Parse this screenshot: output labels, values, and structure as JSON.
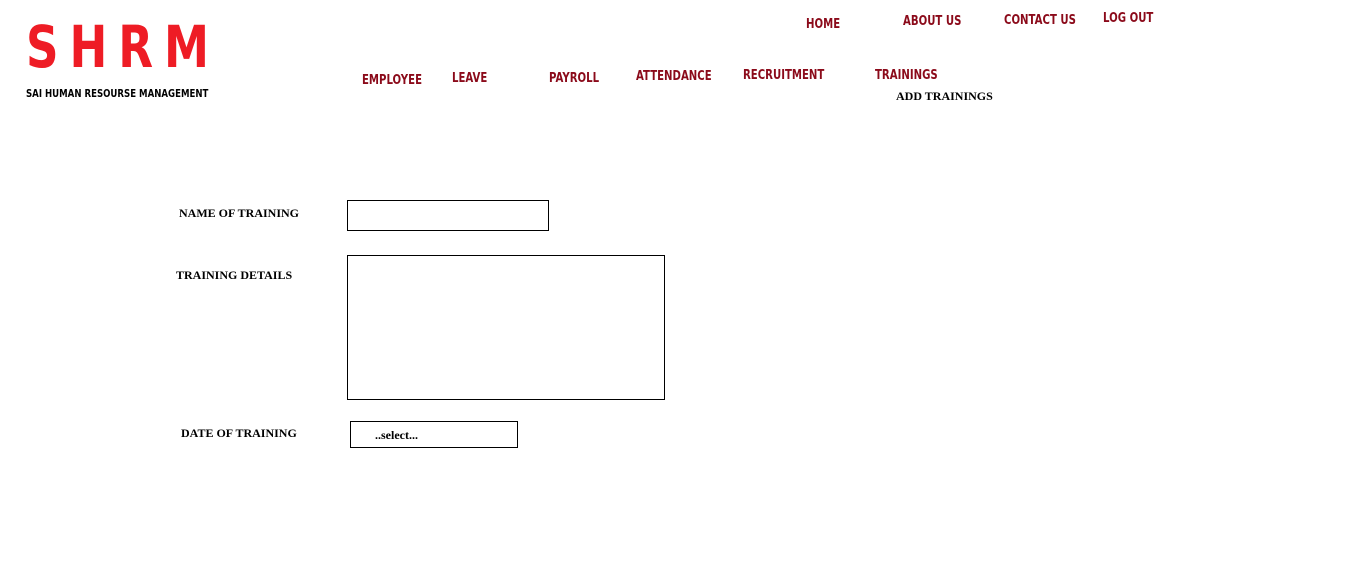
{
  "brand": {
    "logo_text": "SHRM",
    "tagline": "SAI HUMAN RESOURSE MANAGEMENT",
    "logo_color": "#ee1c25"
  },
  "top_nav": {
    "home": "HOME",
    "about": "ABOUT US",
    "contact": "CONTACT US",
    "logout": "LOG OUT"
  },
  "main_nav": {
    "employee": "EMPLOYEE",
    "leave": "LEAVE",
    "payroll": "PAYROLL",
    "attendance": "ATTENDANCE",
    "recruitment": "RECRUITMENT",
    "trainings": "TRAININGS"
  },
  "nav_color": "#8b0a1a",
  "page": {
    "subtitle": "ADD TRAININGS"
  },
  "form": {
    "name_label": "NAME OF TRAINING",
    "name_value": "",
    "details_label": "TRAINING DETAILS",
    "details_value": "",
    "date_label": "DATE OF TRAINING",
    "date_selected": "..select..."
  }
}
